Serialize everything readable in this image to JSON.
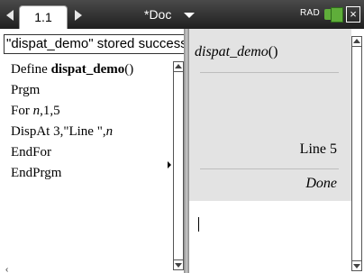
{
  "header": {
    "tab_label": "1.1",
    "doc_title": "*Doc",
    "angle_mode": "RAD",
    "close_label": "×"
  },
  "editor": {
    "status_message": "\"dispat_demo\" stored successfully",
    "lines": [
      {
        "parts": [
          {
            "text": "Define ",
            "style": "normal"
          },
          {
            "text": "dispat_demo",
            "style": "bold"
          },
          {
            "text": "()",
            "style": "normal"
          }
        ]
      },
      {
        "parts": [
          {
            "text": "Prgm",
            "style": "normal"
          }
        ]
      },
      {
        "parts": [
          {
            "text": "For ",
            "style": "normal"
          },
          {
            "text": "n",
            "style": "italic"
          },
          {
            "text": ",1,5",
            "style": "normal"
          }
        ]
      },
      {
        "parts": [
          {
            "text": "DispAt 3,\"Line \",",
            "style": "normal"
          },
          {
            "text": "n",
            "style": "italic"
          }
        ]
      },
      {
        "parts": [
          {
            "text": "EndFor",
            "style": "normal"
          }
        ]
      },
      {
        "parts": [
          {
            "text": "EndPrgm",
            "style": "normal"
          }
        ]
      }
    ],
    "bottom_glyph": "‹"
  },
  "calculator": {
    "entry_name": "dispat_demo",
    "entry_parens": "()",
    "output_line": "Line 5",
    "output_result": "Done"
  },
  "colors": {
    "battery": "#5fae3a",
    "history_bg": "#e3e3e3"
  }
}
